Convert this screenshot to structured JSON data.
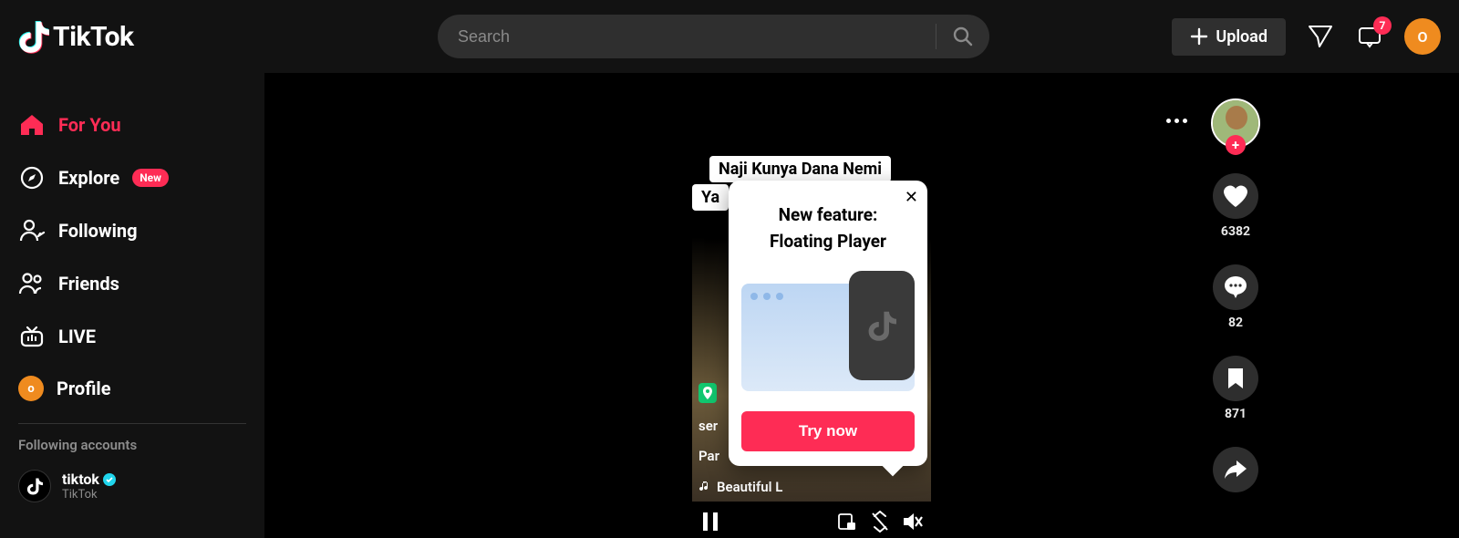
{
  "brand": "TikTok",
  "search": {
    "placeholder": "Search"
  },
  "header": {
    "upload_label": "Upload",
    "inbox_badge": "7",
    "avatar_initial": "O"
  },
  "sidebar": {
    "items": [
      {
        "label": "For You"
      },
      {
        "label": "Explore",
        "pill": "New"
      },
      {
        "label": "Following"
      },
      {
        "label": "Friends"
      },
      {
        "label": "LIVE"
      },
      {
        "label": "Profile"
      }
    ],
    "profile_initial": "o",
    "following_header": "Following accounts",
    "account": {
      "username": "tiktok",
      "display": "TikTok"
    }
  },
  "video": {
    "caption_line1": "Naji Kunya Dana Nemi",
    "caption_line2_prefix": "Ya",
    "overlay_line1": "ser",
    "overlay_line2": "Par",
    "music": "Beautiful L"
  },
  "popup": {
    "title_line1": "New feature:",
    "title_line2": "Floating Player",
    "button": "Try now"
  },
  "actions": {
    "likes": "6382",
    "comments": "82",
    "saves": "871"
  }
}
